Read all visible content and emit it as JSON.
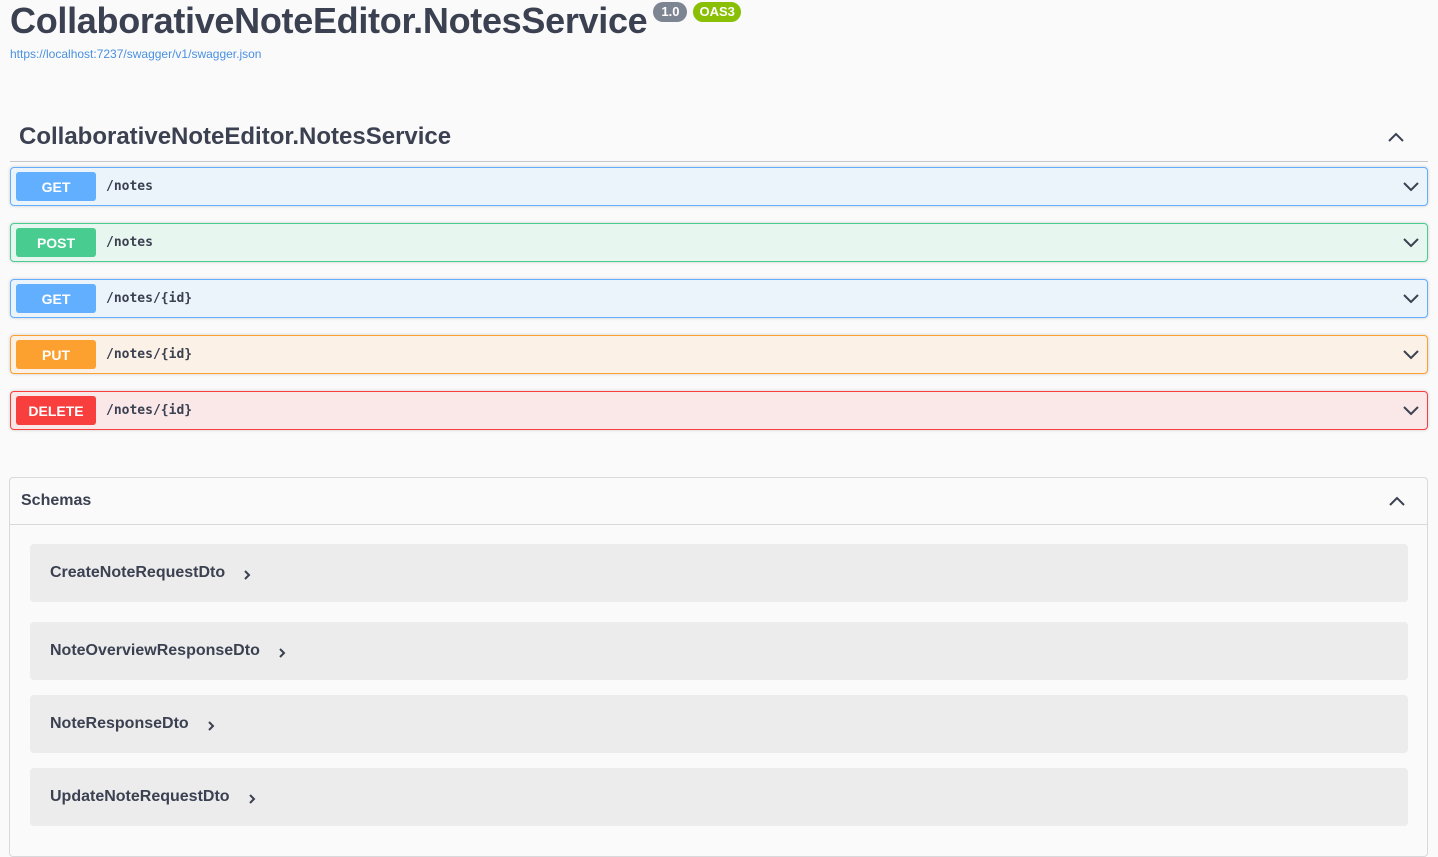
{
  "info": {
    "title": "CollaborativeNoteEditor.NotesService",
    "version": "1.0",
    "oas": "OAS3",
    "spec_url": "https://localhost:7237/swagger/v1/swagger.json"
  },
  "tag": {
    "name": "CollaborativeNoteEditor.NotesService"
  },
  "operations": [
    {
      "method": "GET",
      "path": "/notes",
      "color": "#61affe"
    },
    {
      "method": "POST",
      "path": "/notes",
      "color": "#49cc90"
    },
    {
      "method": "GET",
      "path": "/notes/{id}",
      "color": "#61affe"
    },
    {
      "method": "PUT",
      "path": "/notes/{id}",
      "color": "#fca130"
    },
    {
      "method": "DELETE",
      "path": "/notes/{id}",
      "color": "#f93e3e"
    }
  ],
  "schemas": {
    "title": "Schemas",
    "models": [
      {
        "name": "CreateNoteRequestDto"
      },
      {
        "name": "NoteOverviewResponseDto"
      },
      {
        "name": "NoteResponseDto"
      },
      {
        "name": "UpdateNoteRequestDto"
      }
    ]
  },
  "icons": {
    "collapse": "chevron-up-icon",
    "expand": "chevron-down-icon",
    "model_expand": "chevron-right-icon"
  }
}
